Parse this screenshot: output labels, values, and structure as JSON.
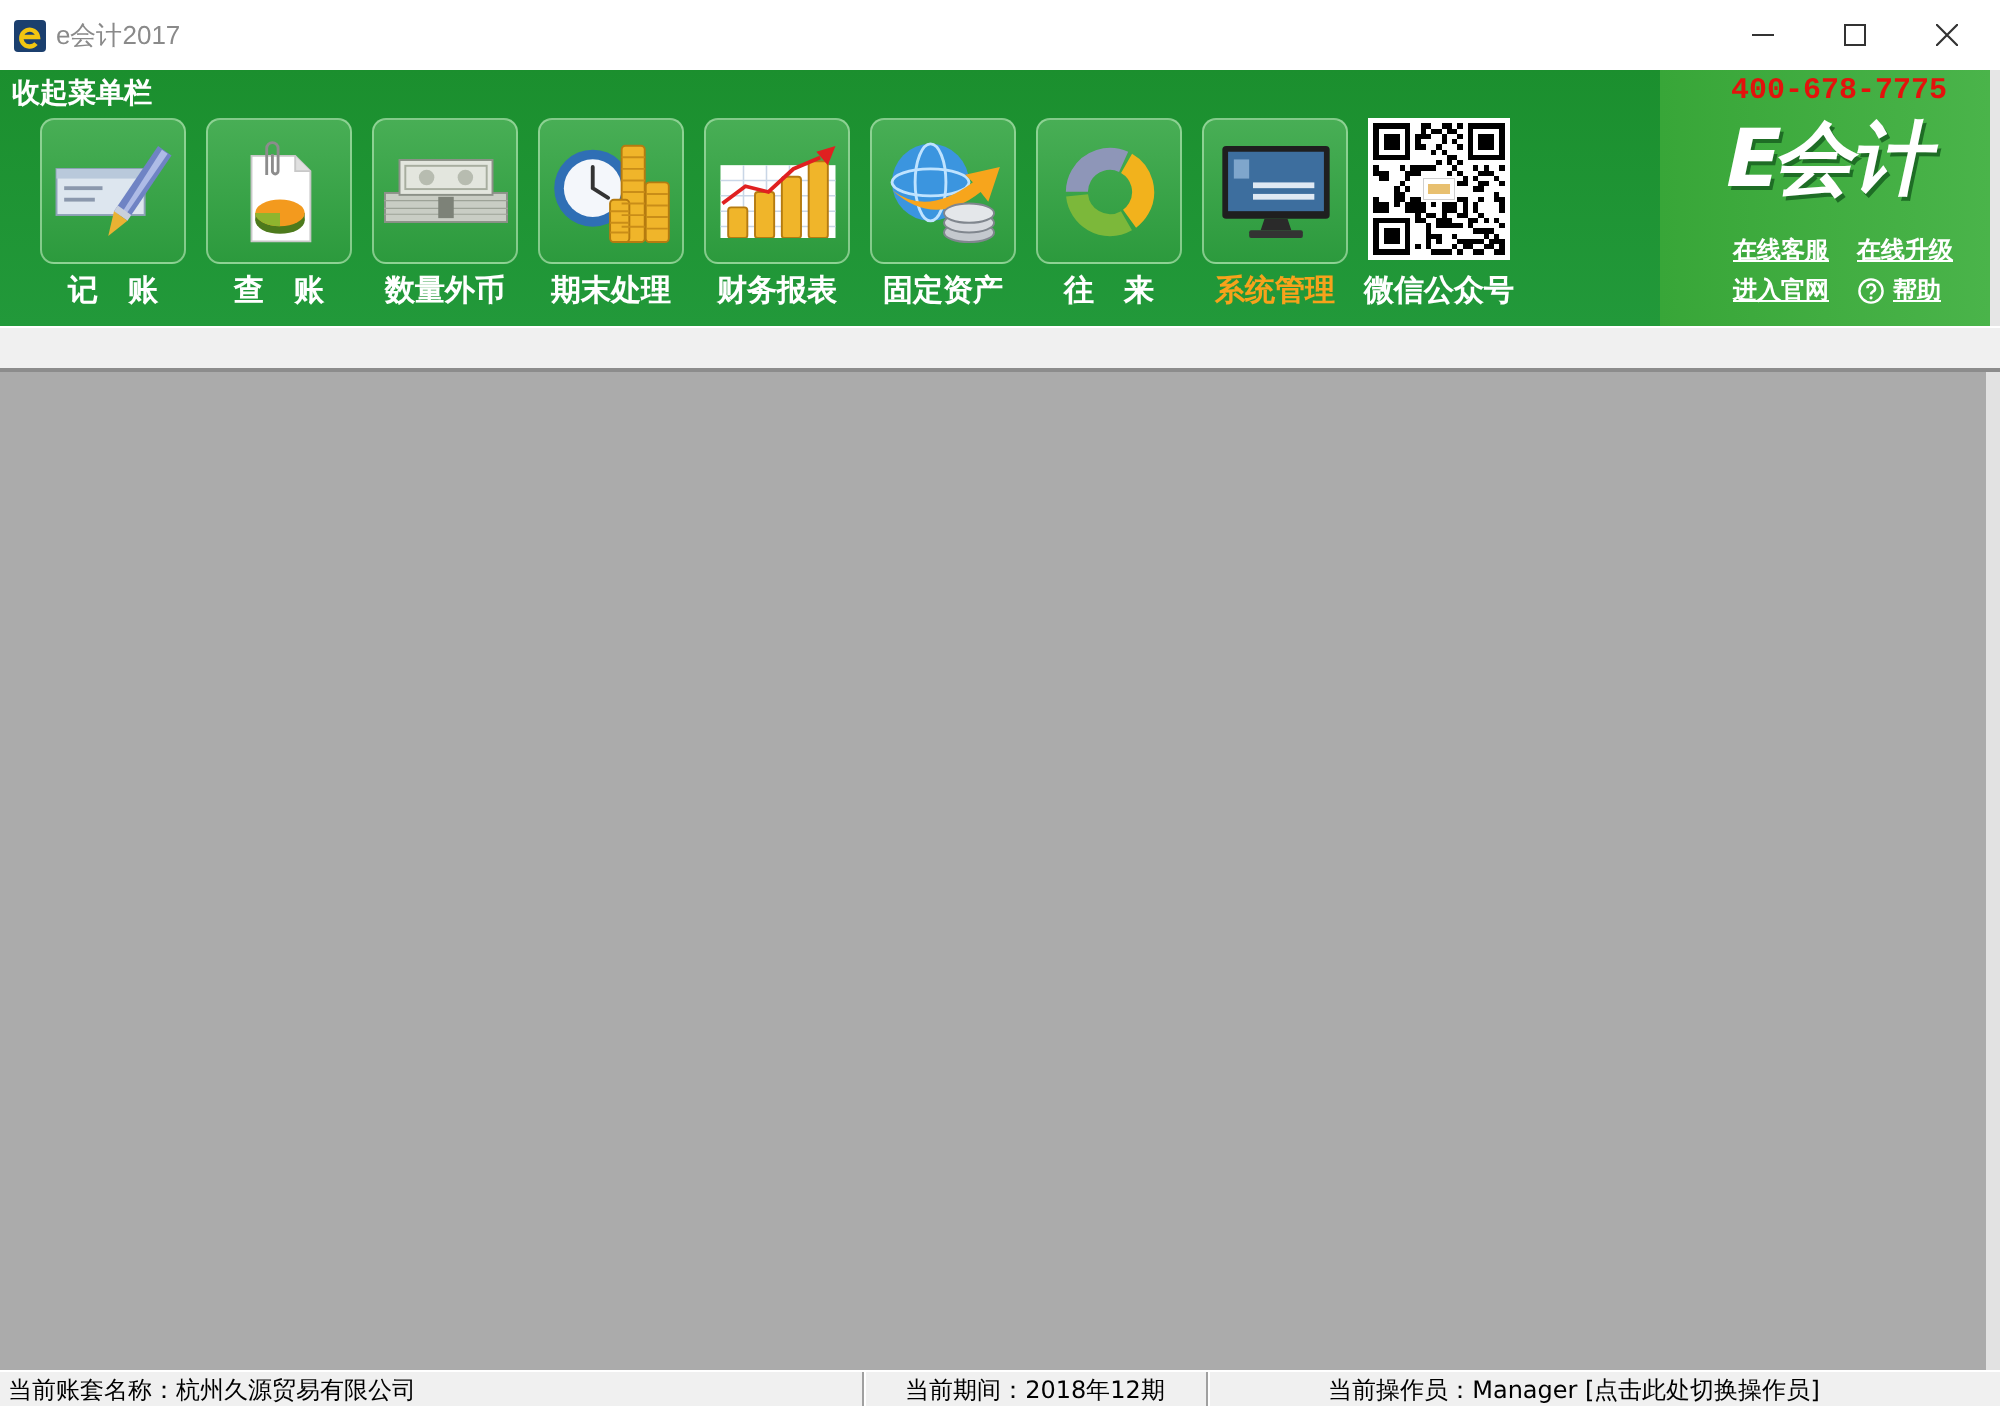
{
  "window": {
    "title": "e会计2017"
  },
  "toolbar": {
    "collapse_label": "收起菜单栏",
    "items": [
      {
        "label": "记　账",
        "selected": false
      },
      {
        "label": "查　账",
        "selected": false
      },
      {
        "label": "数量外币",
        "selected": false
      },
      {
        "label": "期末处理",
        "selected": false
      },
      {
        "label": "财务报表",
        "selected": false
      },
      {
        "label": "固定资产",
        "selected": false
      },
      {
        "label": "往　来",
        "selected": false
      },
      {
        "label": "系统管理",
        "selected": true
      }
    ],
    "wechat": {
      "label": "微信公众号"
    }
  },
  "brand": {
    "hotline": "400-678-7775",
    "logo": "E会计",
    "links": [
      {
        "label": "在线客服",
        "kind": "plain"
      },
      {
        "label": "在线升级",
        "kind": "plain"
      },
      {
        "label": "进入官网",
        "kind": "plain"
      },
      {
        "label": "帮助",
        "kind": "help"
      }
    ]
  },
  "status_bar": [
    {
      "text": "当前账套名称：杭州久源贸易有限公司"
    },
    {
      "text": "当前期间：2018年12期"
    },
    {
      "text": "当前操作员：Manager [点击此处切换操作员]"
    }
  ]
}
